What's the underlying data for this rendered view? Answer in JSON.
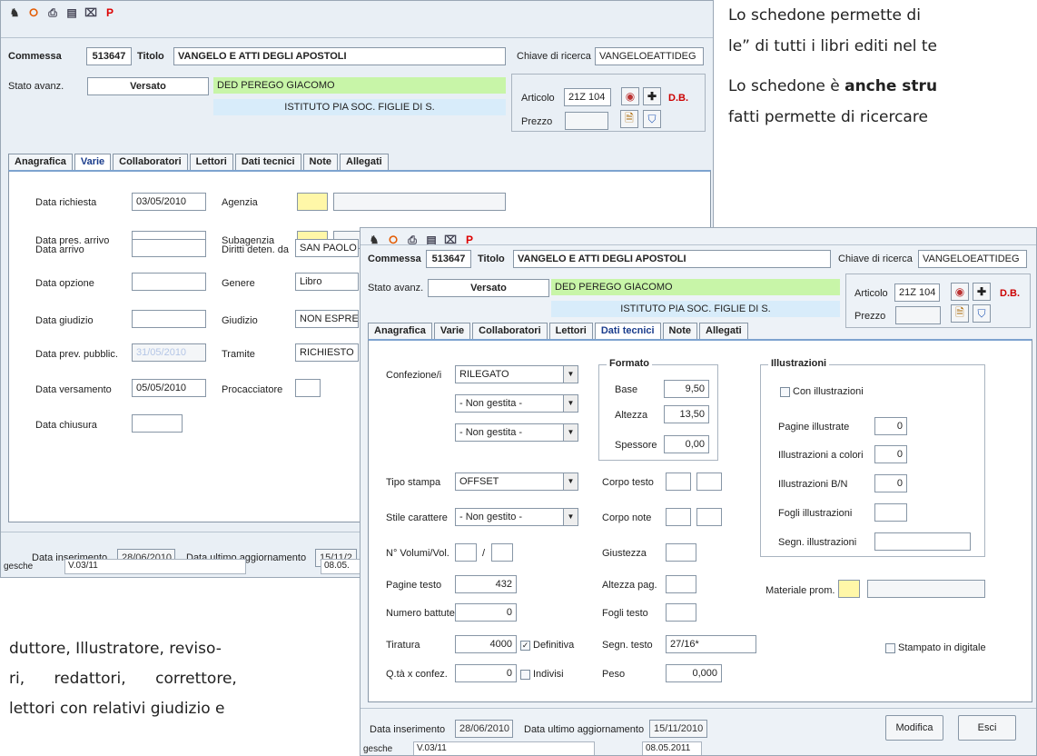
{
  "doc": {
    "line1": "Lo schedone permette di",
    "line2": "le” di tutti i libri editi nel te",
    "line3a": "Lo schedone è ",
    "line3b": "anche stru",
    "line4": "fatti permette di ricercare",
    "line5": "duttore, Illustratore, reviso-",
    "line6": "ri,      redattori,      correttore,",
    "line7": "lettori con relativi giudizio e"
  },
  "header": {
    "commessa_label": "Commessa",
    "commessa_value": "513647",
    "titolo_label": "Titolo",
    "titolo_value": "VANGELO E ATTI DEGLI APOSTOLI",
    "chiave_label": "Chiave di ricerca",
    "chiave_value": "VANGELOEATTIDEG",
    "stato_label": "Stato avanz.",
    "stato_value": "Versato",
    "ded_value": "DED  PEREGO GIACOMO",
    "istituto_value": "ISTITUTO PIA SOC. FIGLIE DI S.",
    "articolo_label": "Articolo",
    "articolo_value": "21Z 104",
    "prezzo_label": "Prezzo",
    "db_label": "D.B."
  },
  "tabs": [
    "Anagrafica",
    "Varie",
    "Collaboratori",
    "Lettori",
    "Dati tecnici",
    "Note",
    "Allegati"
  ],
  "back": {
    "fields_left": [
      {
        "label": "Data richiesta",
        "value": "03/05/2010"
      },
      {
        "label": "Data pres. arrivo",
        "value": ""
      },
      {
        "label": "Data arrivo",
        "value": ""
      },
      {
        "label": "Data opzione",
        "value": ""
      },
      {
        "label": "Data giudizio",
        "value": ""
      },
      {
        "label": "Data prev. pubblic.",
        "value": "31/05/2010"
      },
      {
        "label": "Data versamento",
        "value": "05/05/2010"
      },
      {
        "label": "Data chiusura",
        "value": ""
      }
    ],
    "fields_right": [
      {
        "label": "Agenzia",
        "value": ""
      },
      {
        "label": "Subagenzia",
        "value": ""
      },
      {
        "label": "Diritti deten. da",
        "value": "SAN PAOLO"
      },
      {
        "label": "Genere",
        "value": "Libro"
      },
      {
        "label": "Giudizio",
        "value": "NON ESPRE"
      },
      {
        "label": "Tramite",
        "value": "RICHIESTO"
      },
      {
        "label": "Procacciatore",
        "value": ""
      }
    ],
    "ins_label": "Data inserimento",
    "ins_value": "28/06/2010",
    "agg_label": "Data ultimo aggiornamento",
    "agg_value": "15/11/2",
    "user": "gesche",
    "version": "V.03/11",
    "date": "08.05."
  },
  "front": {
    "confezione_label": "Confezione/i",
    "confezione_values": [
      "RILEGATO",
      "- Non gestita -",
      "- Non gestita -"
    ],
    "formato_title": "Formato",
    "formato": [
      {
        "label": "Base",
        "value": "9,50"
      },
      {
        "label": "Altezza",
        "value": "13,50"
      },
      {
        "label": "Spessore",
        "value": "0,00"
      }
    ],
    "illustrazioni_title": "Illustrazioni",
    "con_illustrazioni": "Con illustrazioni",
    "ill_fields": [
      {
        "label": "Pagine illustrate",
        "value": "0"
      },
      {
        "label": "Illustrazioni a colori",
        "value": "0"
      },
      {
        "label": "Illustrazioni B/N",
        "value": "0"
      },
      {
        "label": "Fogli illustrazioni",
        "value": ""
      },
      {
        "label": "Segn. illustrazioni",
        "value": ""
      }
    ],
    "tipo_stampa_label": "Tipo stampa",
    "tipo_stampa_value": "OFFSET",
    "stile_label": "Stile carattere",
    "stile_value": "- Non gestito -",
    "volumi_label": "N° Volumi/Vol.",
    "volumi_sep": "/",
    "pagine_label": "Pagine testo",
    "pagine_value": "432",
    "battute_label": "Numero battute",
    "battute_value": "0",
    "tiratura_label": "Tiratura",
    "tiratura_value": "4000",
    "definitiva_label": "Definitiva",
    "qta_label": "Q.tà x confez.",
    "qta_value": "0",
    "indivisi_label": "Indivisi",
    "corpo_testo_label": "Corpo testo",
    "corpo_note_label": "Corpo note",
    "giustezza_label": "Giustezza",
    "altezza_pag_label": "Altezza pag.",
    "fogli_testo_label": "Fogli testo",
    "segn_testo_label": "Segn. testo",
    "segn_testo_value": "27/16*",
    "peso_label": "Peso",
    "peso_value": "0,000",
    "materiale_label": "Materiale prom.",
    "stampato_label": "Stampato in digitale",
    "ins_label": "Data inserimento",
    "ins_value": "28/06/2010",
    "agg_label": "Data ultimo aggiornamento",
    "agg_value": "15/11/2010",
    "modifica": "Modifica",
    "esci": "Esci",
    "user": "gesche",
    "version": "V.03/11",
    "date": "08.05.2011"
  }
}
